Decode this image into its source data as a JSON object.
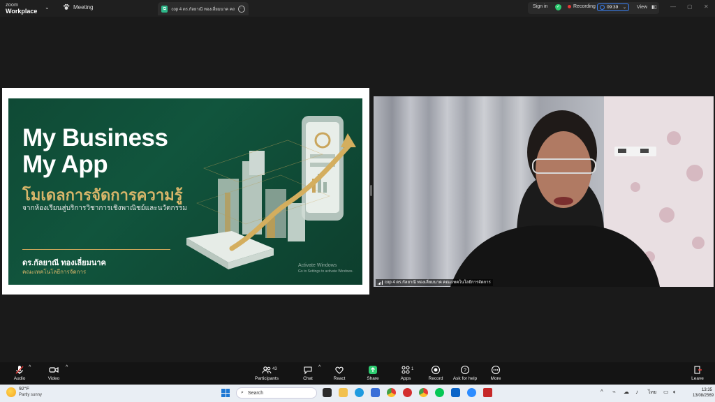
{
  "titlebar": {
    "brand_small": "zoom",
    "brand_big": "Workplace",
    "meeting_label": "Meeting",
    "tab_label": "cop 4 ดร.กัลยาณี ทองเลี่ยมนาค คณะเทคโนโลยีการจัดการ",
    "signin_label": "Sign in",
    "recording_label": "Recording",
    "timer": "09:39",
    "view_label": "View"
  },
  "slide": {
    "title_line1": "My Business",
    "title_line2": "My App",
    "subtitle": "โมเดลการจัดการความรู้",
    "subtitle2": "จากห้องเรียนสู่บริการวิชาการเชิงพาณิชย์และนวัตกรรม",
    "author": "ดร.กัลยาณี ทองเลี่ยมนาค",
    "faculty": "คณะเทคโนโลยีการจัดการ",
    "watermark_title": "Activate Windows",
    "watermark_sub": "Go to Settings to activate Windows."
  },
  "video": {
    "name_tag": "cop 4 ดร.กัลยาณี ทองเลี่ยมนาค คณะเทคโนโลยีการจัดการ"
  },
  "toolbar": {
    "audio": "Audio",
    "video": "Video",
    "participants": "Participants",
    "participants_count": "43",
    "chat": "Chat",
    "react": "React",
    "share": "Share",
    "apps": "Apps",
    "apps_count": "1",
    "record": "Record",
    "ask_help": "Ask for help",
    "more": "More",
    "leave": "Leave"
  },
  "taskbar": {
    "temp": "92°F",
    "weather": "Partly sunny",
    "search_placeholder": "Search",
    "lang": "ไทย",
    "time": "13:35",
    "date": "13/08/2569"
  },
  "colors": {
    "slide_green": "#11553d",
    "gold": "#d9b66a",
    "share_green": "#2ecc71",
    "record_red": "#e53935",
    "accent_blue": "#3b82f6"
  }
}
